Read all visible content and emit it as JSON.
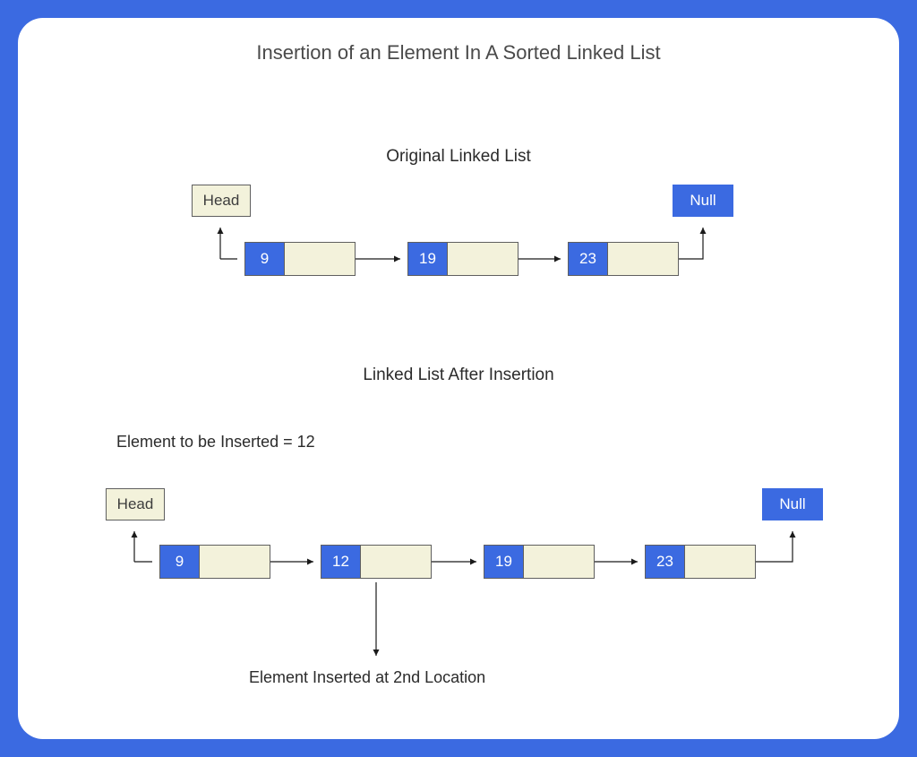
{
  "title": "Insertion of an Element In A Sorted Linked List",
  "section1": {
    "heading": "Original Linked List",
    "head_label": "Head",
    "null_label": "Null",
    "nodes": [
      "9",
      "19",
      "23"
    ]
  },
  "section2": {
    "heading": "Linked List After Insertion",
    "insert_note": "Element to be Inserted = 12",
    "head_label": "Head",
    "null_label": "Null",
    "nodes": [
      "9",
      "12",
      "19",
      "23"
    ],
    "callout": "Element  Inserted at 2nd Location"
  }
}
